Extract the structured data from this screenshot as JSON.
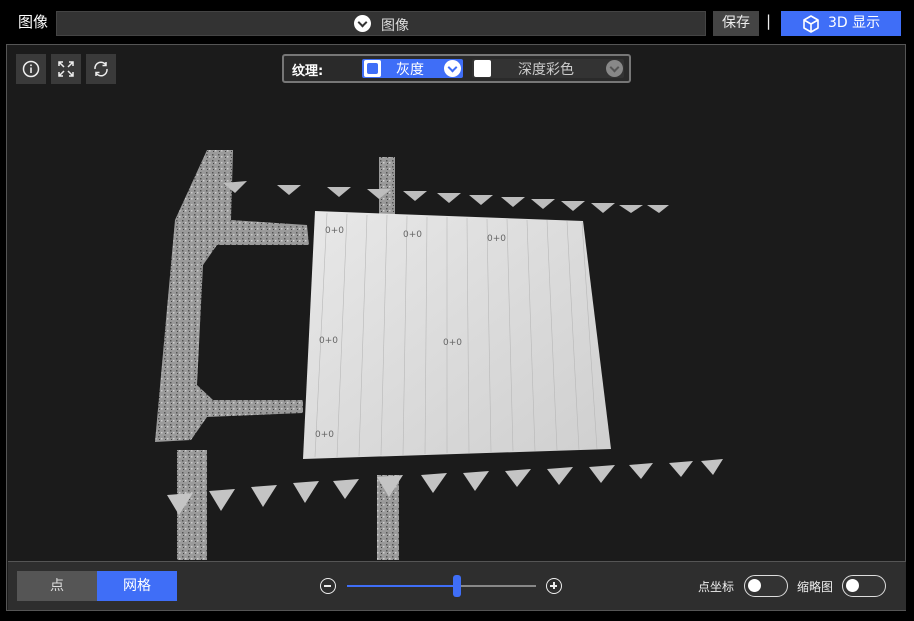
{
  "header": {
    "title": "图像",
    "image_select_value": "图像",
    "save_label": "保存",
    "separator": "|",
    "view3d_label": "3D 显示"
  },
  "toolbar": {
    "info_icon": "info-icon",
    "fit_icon": "fit-view-icon",
    "reset_icon": "refresh-icon"
  },
  "texture": {
    "label": "纹理:",
    "gray": {
      "label": "灰度",
      "checked": true
    },
    "depth": {
      "label": "深度彩色",
      "checked": false
    }
  },
  "bottom": {
    "point_label": "点",
    "mesh_label": "网格",
    "active_view": "网格",
    "zoom_level": 0.58,
    "point_coord_label": "点坐标",
    "point_coord_on": false,
    "thumbnail_label": "缩略图",
    "thumbnail_on": false
  },
  "scene_annotations": [
    "0+0",
    "0+0",
    "0+0",
    "0+0",
    "0+0",
    "0+0"
  ],
  "colors": {
    "accent": "#3f6ef7",
    "background": "#1b1b1b",
    "bar": "#2e2e2e"
  }
}
